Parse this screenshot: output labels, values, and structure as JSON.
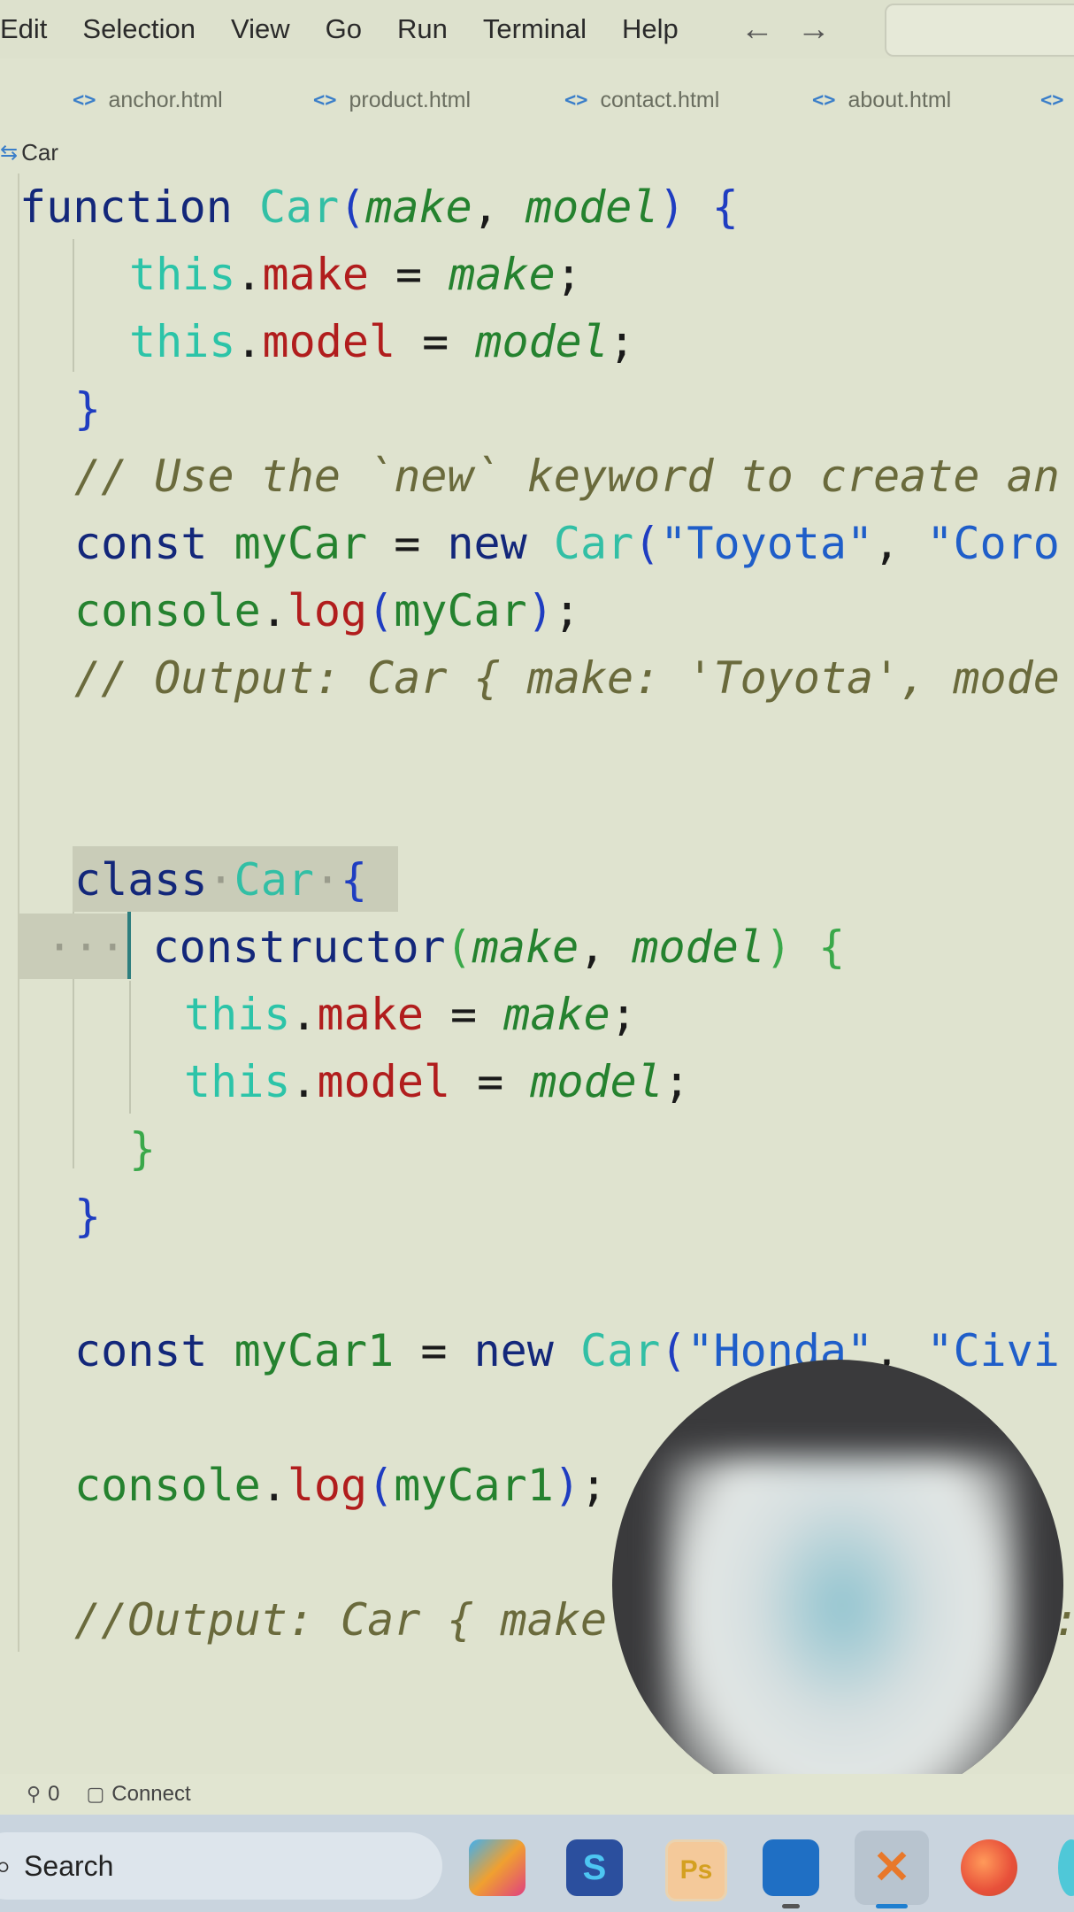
{
  "menubar": {
    "items": [
      "Edit",
      "Selection",
      "View",
      "Go",
      "Run",
      "Terminal",
      "Help"
    ],
    "back_arrow": "←",
    "forward_arrow": "→"
  },
  "tabs": [
    {
      "label": "anchor.html",
      "icon": "<>"
    },
    {
      "label": "product.html",
      "icon": "<>"
    },
    {
      "label": "contact.html",
      "icon": "<>"
    },
    {
      "label": "about.html",
      "icon": "<>"
    },
    {
      "label": "",
      "icon": "<>"
    }
  ],
  "breadcrumb": {
    "icon": "class-icon",
    "label": "Car"
  },
  "code": {
    "l1_kw": "function",
    "l1_name": "Car",
    "l1_p1": "make",
    "l1_p2": "model",
    "this": "this",
    "make": "make",
    "model": "model",
    "comment1": "// Use the `new` keyword to create an",
    "const": "const",
    "new": "new",
    "myCar": "myCar",
    "car": "Car",
    "toyota": "\"Toyota\"",
    "corolla": "\"Coro",
    "console": "console",
    "log": "log",
    "comment2": "// Output: Car { make: 'Toyota', mode",
    "class": "class",
    "constructor": "constructor",
    "myCar1": "myCar1",
    "honda": "\"Honda\"",
    "civic": "\"Civi",
    "comment3": "//Output: Car { make",
    "comment3_tail": ":"
  },
  "statusbar": {
    "ports_icon": "ports-icon",
    "ports_count": "0",
    "connect_icon": "remote-icon",
    "connect_label": "Connect"
  },
  "taskbar": {
    "search_label": "Search",
    "apps": [
      "copilot",
      "sublime-text",
      "photoshop",
      "file-explorer",
      "vscode",
      "edge"
    ],
    "photoshop_label": "Ps"
  },
  "colors": {
    "editor_bg": "#dfe3cf",
    "keyword": "#13277a",
    "class_name": "#32bfa5",
    "property": "#b11d1d",
    "param": "#25822f",
    "comment": "#6a6a3c"
  }
}
